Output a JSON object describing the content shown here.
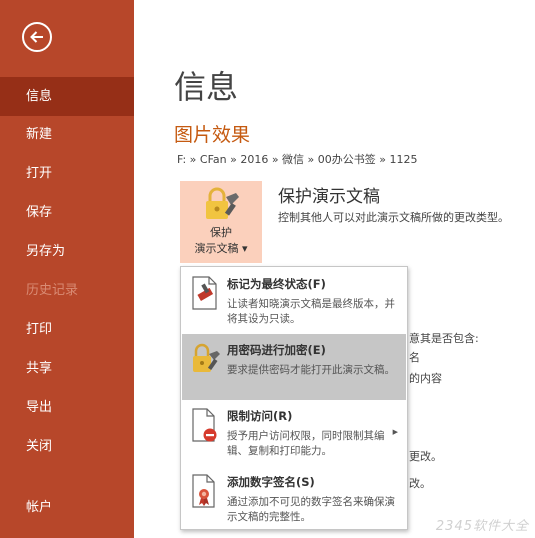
{
  "sidebar": {
    "items": [
      {
        "label": "信息"
      },
      {
        "label": "新建"
      },
      {
        "label": "打开"
      },
      {
        "label": "保存"
      },
      {
        "label": "另存为"
      },
      {
        "label": "历史记录"
      },
      {
        "label": "打印"
      },
      {
        "label": "共享"
      },
      {
        "label": "导出"
      },
      {
        "label": "关闭"
      },
      {
        "label": "帐户"
      }
    ],
    "active_index": 0,
    "disabled_index": 5
  },
  "main": {
    "title": "信息",
    "file_name": "图片效果",
    "path": "F: » CFan » 2016 » 微信 » 00办公书签 » 1125",
    "protect": {
      "button_line1": "保护",
      "button_line2": "演示文稿 ▾",
      "heading": "保护演示文稿",
      "description": "控制其他人可以对此演示文稿所做的更改类型。"
    },
    "background_fragments": [
      "意其是否包含:",
      "名",
      "的内容",
      "更改。",
      "改。"
    ]
  },
  "menu": {
    "items": [
      {
        "title": "标记为最终状态(F)",
        "desc": "让读者知晓演示文稿是最终版本，并将其设为只读。",
        "icon": "mark-final-icon"
      },
      {
        "title": "用密码进行加密(E)",
        "desc": "要求提供密码才能打开此演示文稿。",
        "icon": "lock-key-icon"
      },
      {
        "title": "限制访问(R)",
        "desc": "授予用户访问权限，同时限制其编辑、复制和打印能力。",
        "icon": "restrict-access-icon"
      },
      {
        "title": "添加数字签名(S)",
        "desc": "通过添加不可见的数字签名来确保演示文稿的完整性。",
        "icon": "digital-signature-icon"
      }
    ],
    "highlighted_index": 1
  },
  "colors": {
    "sidebar_bg": "#b7472a",
    "sidebar_active": "#962f17",
    "accent": "#c55a11",
    "protect_button_bg": "#fbd0bc",
    "menu_highlight": "#c6c6c6"
  },
  "watermark": "2345软件大全"
}
